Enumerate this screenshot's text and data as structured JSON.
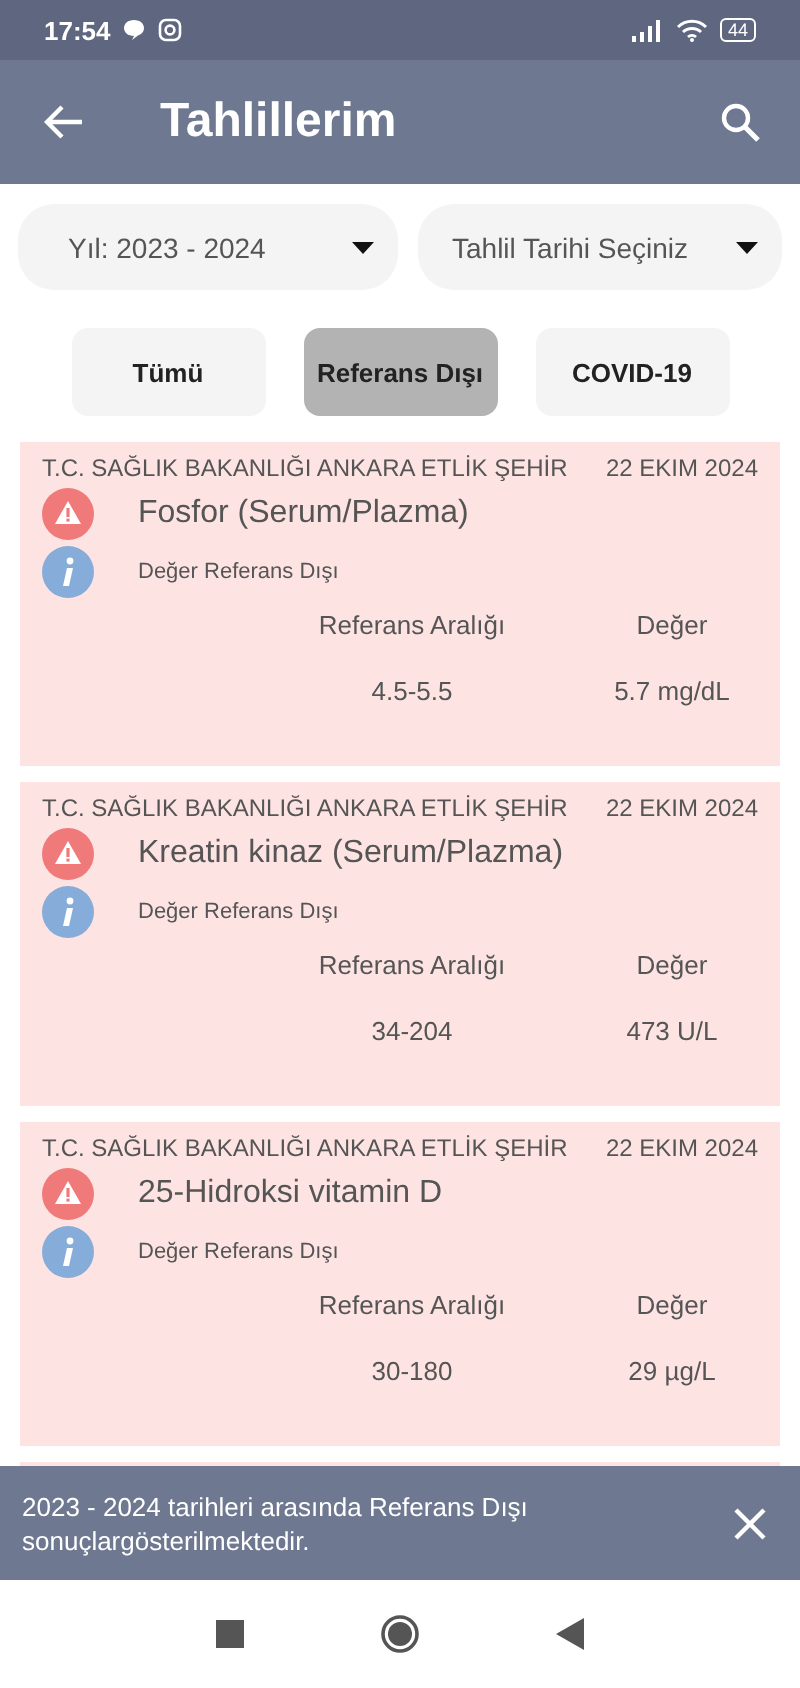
{
  "status_bar": {
    "time": "17:54",
    "battery": "44"
  },
  "app_bar": {
    "title": "Tahlillerim"
  },
  "filters": [
    {
      "value": "Yıl: 2023 - 2024"
    },
    {
      "value": "Tahlil Tarihi Seçiniz"
    }
  ],
  "tabs": [
    {
      "label": "Tümü",
      "selected": false
    },
    {
      "label": "Referans Dışı",
      "selected": true
    },
    {
      "label": "COVID-19",
      "selected": false
    }
  ],
  "results": [
    {
      "hospital": "T.C. SAĞLIK BAKANLIĞI ANKARA ETLİK ŞEHİR",
      "date": "22 EKIM 2024",
      "test": "Fosfor (Serum/Plazma)",
      "note": "Değer Referans Dışı",
      "range_label": "Referans Aralığı",
      "value_label": "Değer",
      "range": "4.5-5.5",
      "value": "5.7 mg/dL"
    },
    {
      "hospital": "T.C. SAĞLIK BAKANLIĞI ANKARA ETLİK ŞEHİR",
      "date": "22 EKIM 2024",
      "test": "Kreatin kinaz (Serum/Plazma)",
      "note": "Değer Referans Dışı",
      "range_label": "Referans Aralığı",
      "value_label": "Değer",
      "range": "34-204",
      "value": "473 U/L"
    },
    {
      "hospital": "T.C. SAĞLIK BAKANLIĞI ANKARA ETLİK ŞEHİR",
      "date": "22 EKIM 2024",
      "test": "25-Hidroksi vitamin D",
      "note": "Değer Referans Dışı",
      "range_label": "Referans Aralığı",
      "value_label": "Değer",
      "range": "30-180",
      "value": "29 µg/L"
    }
  ],
  "snackbar": {
    "message": "2023 - 2024 tarihleri arasında Referans Dışı sonuçlargösterilmektedir."
  }
}
